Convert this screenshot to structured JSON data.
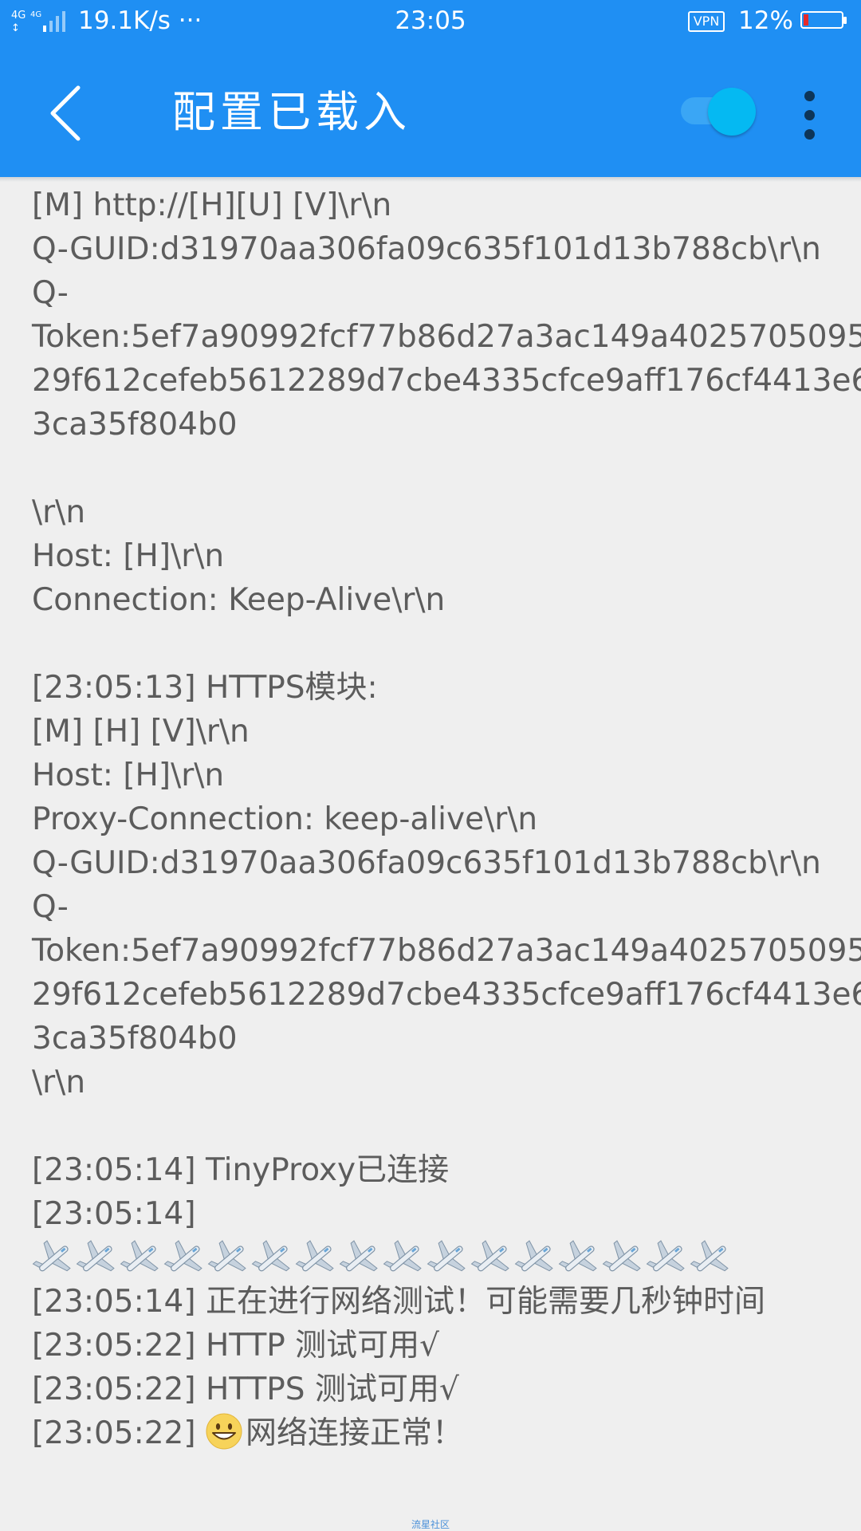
{
  "status_bar": {
    "network_type": "4G 4G",
    "speed": "19.1K/s ···",
    "time": "23:05",
    "vpn": "VPN",
    "battery_percent": "12%",
    "battery_level": 0.12,
    "signal_icon": "cell-signal-icon"
  },
  "app_bar": {
    "back_icon": "chevron-left-icon",
    "title": "配置已载入",
    "toggle_on": true,
    "menu_icon": "more-vertical-icon"
  },
  "log": {
    "lines": [
      "[M] http://[H][U] [V]\\r\\n",
      "Q-GUID:d31970aa306fa09c635f101d13b788cb\\r\\n",
      "Q-",
      "Token:5ef7a90992fcf77b86d27a3ac149a4025705095",
      "29f612cefeb5612289d7cbe4335cfce9aff176cf4413e6",
      "3ca35f804b0",
      "",
      "\\r\\n",
      "Host: [H]\\r\\n",
      "Connection: Keep-Alive\\r\\n",
      "",
      "[23:05:13] HTTPS模块:",
      "[M] [H] [V]\\r\\n",
      "Host: [H]\\r\\n",
      "Proxy-Connection: keep-alive\\r\\n",
      "Q-GUID:d31970aa306fa09c635f101d13b788cb\\r\\n",
      "Q-",
      "Token:5ef7a90992fcf77b86d27a3ac149a4025705095",
      "29f612cefeb5612289d7cbe4335cfce9aff176cf4413e6",
      "3ca35f804b0",
      "\\r\\n",
      "",
      "[23:05:14] TinyProxy已连接",
      "[23:05:14]"
    ],
    "plane_count": 16,
    "plane_icon": "airplane-icon",
    "tail_lines": [
      "[23:05:14] 正在进行网络测试！可能需要几秒钟时间",
      "[23:05:22] HTTP 测试可用√",
      "[23:05:22] HTTPS 测试可用√"
    ],
    "final_time": "[23:05:22] ",
    "final_emoji": "grinning-face-icon",
    "final_text": "网络连接正常！"
  },
  "footer": {
    "watermark": "流星社区"
  },
  "colors": {
    "primary": "#1f8ff3",
    "toggle": "#05b9f2",
    "background": "#efefef",
    "text": "#5c5c5c"
  }
}
